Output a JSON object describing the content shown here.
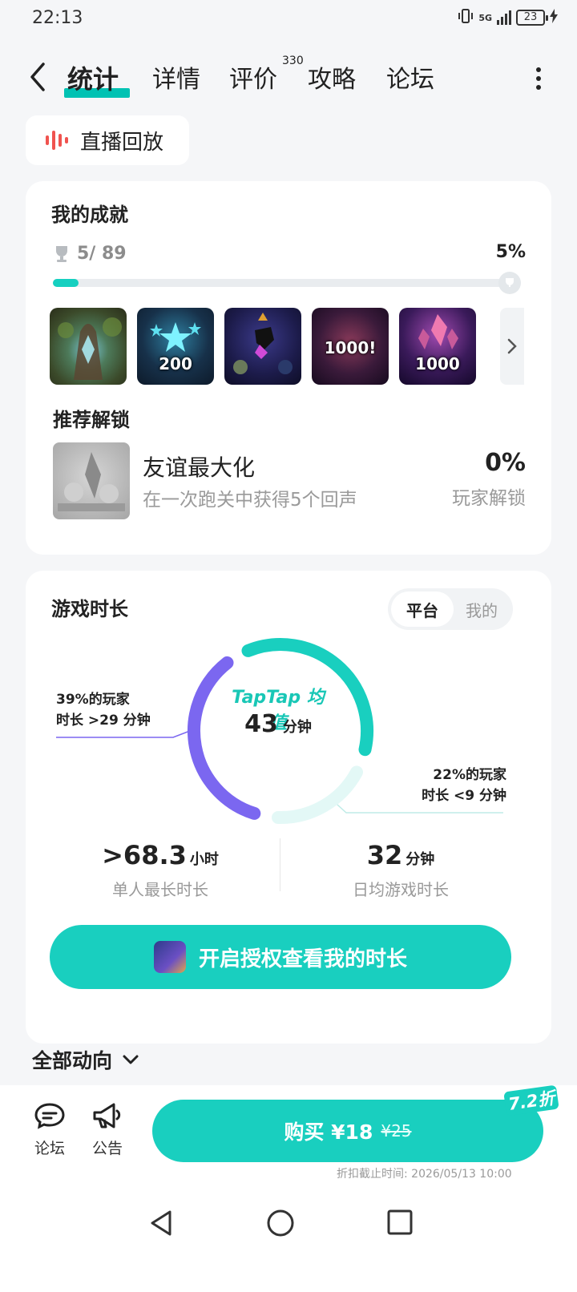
{
  "status_bar": {
    "time": "22:13",
    "network": "5G",
    "battery": "23"
  },
  "nav": {
    "tabs": [
      {
        "label": "统计",
        "active": true
      },
      {
        "label": "详情"
      },
      {
        "label": "评价",
        "badge": "330"
      },
      {
        "label": "攻略"
      },
      {
        "label": "论坛"
      }
    ]
  },
  "replay": {
    "label": "直播回放",
    "icon": "soundwave-icon"
  },
  "achievements": {
    "title": "我的成就",
    "progress_text": "5/ 89",
    "percent_text": "5%",
    "progress": 0.056,
    "tiles": [
      {
        "name": "achievement-tree-crystal",
        "label": ""
      },
      {
        "name": "achievement-stars-200",
        "label": "200"
      },
      {
        "name": "achievement-combat",
        "label": ""
      },
      {
        "name": "achievement-1000-burst",
        "label": "1000!"
      },
      {
        "name": "achievement-crystals-1000",
        "label": "1000"
      }
    ],
    "recommend_title": "推荐解锁",
    "recommend": {
      "name": "友谊最大化",
      "desc": "在一次跑关中获得5个回声",
      "percent": "0%",
      "percent_label": "玩家解锁"
    }
  },
  "playtime": {
    "title": "游戏时长",
    "segments": [
      "平台",
      "我的"
    ],
    "active_segment": 0,
    "donut": {
      "center_label": "TapTap 均值",
      "center_value": "43",
      "center_unit": "分钟",
      "share_purple": 0.39,
      "share_teal": 0.39,
      "share_light": 0.22
    },
    "note_left": [
      "39%的玩家",
      "时长 >29 分钟"
    ],
    "note_right": [
      "22%的玩家",
      "时长 <9 分钟"
    ],
    "stats": [
      {
        "value": ">68.3",
        "unit": "小时",
        "label": "单人最长时长"
      },
      {
        "value": "32",
        "unit": "分钟",
        "label": "日均游戏时长"
      }
    ],
    "cta_label": "开启授权查看我的时长"
  },
  "feed": {
    "label": "全部动向"
  },
  "bottom": {
    "forum_label": "论坛",
    "notice_label": "公告",
    "buy_label": "购买 ¥18",
    "buy_original": "¥25",
    "discount": "7.2折",
    "deadline": "折扣截止时间: 2026/05/13 10:00"
  },
  "colors": {
    "accent": "#19cfbf",
    "purple": "#7b67f0",
    "light_teal": "#e3f8f6"
  }
}
